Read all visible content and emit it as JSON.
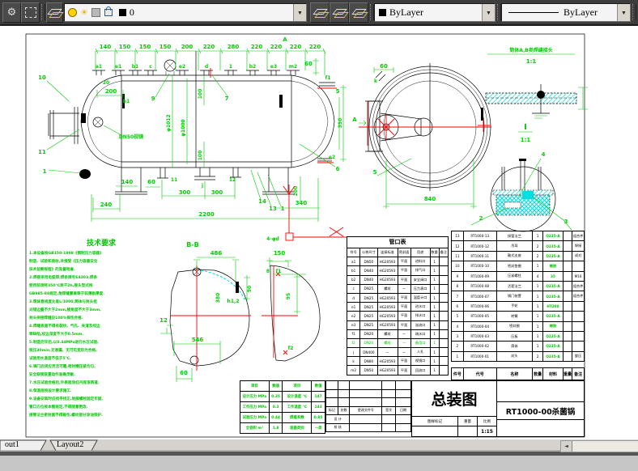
{
  "toolbar": {
    "layer_value": "0",
    "color_value": "ByLayer",
    "linetype_value": "ByLayer"
  },
  "icons": {
    "gear": "⚙",
    "sun": "☀",
    "dropdown_arrow": "▼",
    "scroll_left": "◄"
  },
  "tabs": {
    "tab1": "out1",
    "tab2": "Layout2"
  },
  "front": {
    "dims_top": [
      "140",
      "150",
      "150",
      "150",
      "200",
      "220",
      "280",
      "220",
      "220",
      "220",
      "220"
    ],
    "ports_top": [
      "a1",
      "e1",
      "b1",
      "c",
      "e2",
      "d",
      "1",
      "b2",
      "e3",
      "m2"
    ],
    "labels": {
      "A1": "A",
      "n10": "10",
      "n11": "11",
      "n1L": "1",
      "d20": "20",
      "d200L": "200",
      "b1b": "b1",
      "sight": "DN50视镜",
      "n9": "9",
      "n7": "7",
      "dia1": "φ1012",
      "dia2": "φ1000",
      "d100a": "100",
      "d100b": "100",
      "d60r": "60",
      "f1r": "f1",
      "n5r": "5",
      "e2r": "e2",
      "n6r": "6",
      "d350": "350",
      "d240": "240",
      "d140": "140",
      "d60b": "60",
      "n11b": "11",
      "d300a": "300",
      "nj": "j",
      "d300b": "300",
      "n12b": "12",
      "d2200": "2200",
      "n14": "14",
      "n13": "13",
      "n1b": "1",
      "d340": "340",
      "d200r": "200"
    }
  },
  "end_view": {
    "d60": "60",
    "k": "k",
    "A": "A",
    "n5": "5",
    "d840": "840"
  },
  "weld": {
    "title": "筒体A,B类焊缝接头",
    "scale": "1:1",
    "I": "I",
    "scale2": "1:1"
  },
  "detail": {
    "n2": "2",
    "n3": "3",
    "n4": "4"
  },
  "bb": {
    "title": "B-B",
    "d486": "486",
    "d546": "546",
    "d380": "380",
    "h12": "h1,2",
    "d90": "90",
    "n12": "12",
    "d60": "60",
    "t4d": "4-φd",
    "d150": "150",
    "n8": "8",
    "f1": "f1",
    "d95": "95",
    "f2": "f2"
  },
  "tech": {
    "title": "技术要求",
    "lines": [
      "1.本设备按GB150-1998《钢制压力容器》",
      "制造、试验和验收,并接受《压力容器安全",
      "技术监察规程》的监督检查.",
      "2.焊接采用电弧焊,焊条牌号E4303,焊条",
      "使用前须经350℃烘干2h,接头型式按",
      "GB985-88规定,角焊缝腰高等于较薄板厚度.",
      "3.筒体直线度允差L/1000,筒体与封头组",
      "对错边量不大于2mm,棱角度不大于3mm,",
      "封头拼接焊缝应100%探伤合格.",
      "4.焊缝表面不得有裂纹、气孔、夹渣及咬边",
      "等缺陷,咬边深度不大于0.5mm.",
      "5.制造完毕后,以0.44MPa进行水压试验,",
      "保压30min,无渗漏、无可见变形为合格,",
      "试验用水温度不低于5℃.",
      "6.锅门启闭应灵活可靠,密封圈压紧均匀,",
      "安全联锁装置动作准确灵敏.",
      "7.水压试验合格后,外表面涂红丹底漆两道.",
      "8.保温层按设计要求施工.",
      "9.设备安装时应找平找正,地脚螺栓固定牢固,",
      "管口方位按本图规定,不得随意更改.",
      "接管法兰密封面不得碰伤,螺纹部分涂油保护."
    ]
  },
  "nozzle": {
    "title": "管口表",
    "headers": [
      "符号",
      "公称尺寸",
      "连接标准",
      "密封面",
      "用途",
      "数量",
      "备注"
    ],
    "rows": [
      [
        "a1",
        "DN50",
        "HG20593",
        "平面",
        "进料口",
        "1",
        ""
      ],
      [
        "b1",
        "DN40",
        "HG20593",
        "平面",
        "排气口",
        "1",
        ""
      ],
      [
        "b2",
        "DN40",
        "HG20593",
        "平面",
        "安全阀口",
        "1",
        ""
      ],
      [
        "c",
        "DN25",
        "螺纹",
        "—",
        "压力表口",
        "1",
        ""
      ],
      [
        "d",
        "DN25",
        "HG20593",
        "平面",
        "温度计口",
        "1",
        ""
      ],
      [
        "e1",
        "DN25",
        "HG20593",
        "平面",
        "进水口",
        "1",
        ""
      ],
      [
        "e2",
        "DN25",
        "HG20593",
        "平面",
        "排水口",
        "1",
        ""
      ],
      [
        "e3",
        "DN25",
        "HG20593",
        "平面",
        "溢流口",
        "1",
        ""
      ],
      [
        "f1",
        "DN20",
        "螺纹",
        "—",
        "疏水口",
        "1",
        ""
      ],
      [
        "f2",
        "DN20",
        "螺纹",
        "—",
        "备用口",
        "1",
        ""
      ],
      [
        "j",
        "DN400",
        "—",
        "—",
        "人孔",
        "1",
        ""
      ],
      [
        "k",
        "DN80",
        "HG20593",
        "平面",
        "视镜口",
        "1",
        ""
      ],
      [
        "m2",
        "DN50",
        "HG20593",
        "平面",
        "回流口",
        "1",
        ""
      ]
    ]
  },
  "bom": {
    "headers": [
      "件号",
      "代号",
      "名称",
      "数量",
      "材料",
      "重量",
      "备注"
    ],
    "rows": [
      [
        "13",
        "RT1000-13",
        "接管法兰",
        "1",
        "Q235-A",
        "",
        "组合件"
      ],
      [
        "12",
        "RT1000-12",
        "吊耳",
        "2",
        "Q235-A",
        "",
        "焊接"
      ],
      [
        "11",
        "RT1000-11",
        "鞍式支座",
        "2",
        "Q235-A",
        "",
        "成对"
      ],
      [
        "10",
        "RT1000-10",
        "密封垫圈",
        "1",
        "橡胶",
        "",
        ""
      ],
      [
        "9",
        "RT1000-09",
        "压紧螺柱",
        "4",
        "35",
        "",
        "M16"
      ],
      [
        "8",
        "RT1000-08",
        "活套法兰",
        "1",
        "Q235-A",
        "",
        "组合件"
      ],
      [
        "7",
        "RT1000-07",
        "锅门装置",
        "1",
        "Q235-A",
        "",
        "组合件"
      ],
      [
        "6",
        "RT1000-06",
        "手轮",
        "1",
        "HT200",
        "",
        ""
      ],
      [
        "5",
        "RT1000-05",
        "转臂",
        "1",
        "Q235-A",
        "",
        ""
      ],
      [
        "4",
        "RT1000-04",
        "密封圈",
        "1",
        "橡胶",
        "",
        ""
      ],
      [
        "3",
        "RT1000-03",
        "压板",
        "1",
        "Q235-A",
        "",
        ""
      ],
      [
        "2",
        "RT1000-02",
        "筒体",
        "1",
        "Q235-A",
        "",
        ""
      ],
      [
        "1",
        "RT1000-01",
        "封头",
        "2",
        "Q235-A",
        "",
        "旋压"
      ]
    ]
  },
  "param": {
    "rows": [
      [
        "项目",
        "数值",
        "项目",
        "数值"
      ],
      [
        "设计压力 MPa",
        "0.35",
        "设计温度 ℃",
        "147"
      ],
      [
        "工作压力 MPa",
        "0.3",
        "工作温度 ℃",
        "143"
      ],
      [
        "试验压力 MPa",
        "0.44",
        "焊缝系数",
        "0.85"
      ],
      [
        "全容积 m³",
        "1.8",
        "容器类别",
        "一类"
      ]
    ]
  },
  "sig": {
    "cols": [
      "标记",
      "处数",
      "更改文件号",
      "签字",
      "日期"
    ],
    "r1": "设 计",
    "r2": "校 核"
  },
  "tblock": {
    "title": "总装图",
    "code": "RT1000-00杀菌锅",
    "mark": "图样标记",
    "weight": "重量",
    "scale": "比例",
    "scale_value": "1:15"
  }
}
